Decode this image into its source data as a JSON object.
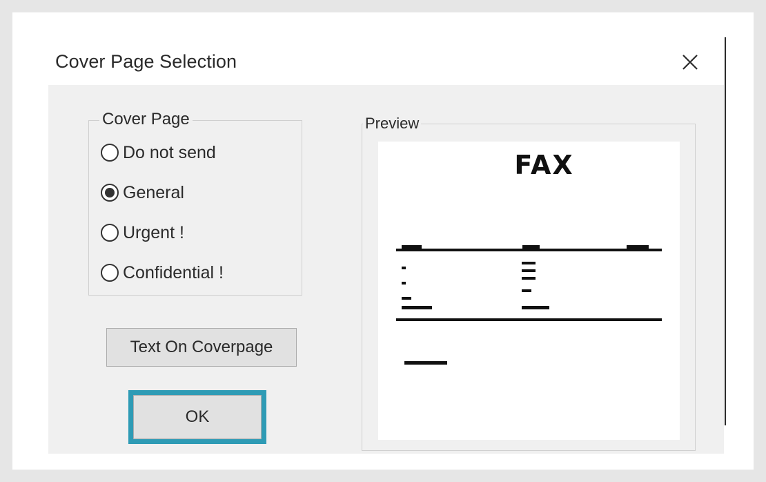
{
  "dialog": {
    "title": "Cover Page Selection"
  },
  "cover_page_group": {
    "label": "Cover Page",
    "options": [
      {
        "label": "Do not send",
        "selected": false
      },
      {
        "label": "General",
        "selected": true
      },
      {
        "label": "Urgent !",
        "selected": false
      },
      {
        "label": "Confidential !",
        "selected": false
      }
    ],
    "selected_value": "General"
  },
  "buttons": {
    "text_on_coverpage": "Text On Coverpage",
    "ok": "OK"
  },
  "preview": {
    "label": "Preview",
    "page_heading": "FAX"
  },
  "colors": {
    "focus_outline": "#2e9bb5",
    "client_background": "#f0f0f0"
  },
  "icons": {
    "close": "close-icon"
  }
}
